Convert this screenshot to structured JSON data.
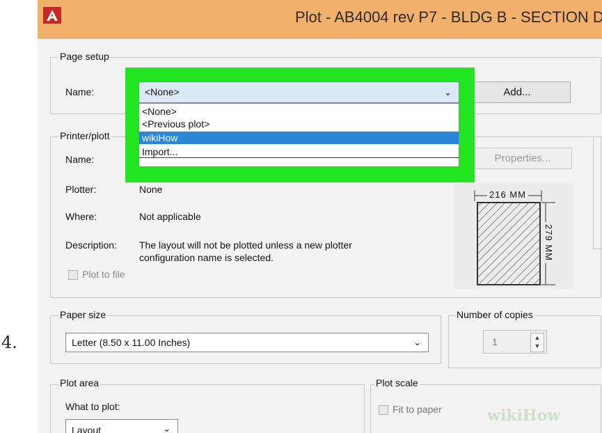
{
  "step_number": "4.",
  "window": {
    "title": "Plot - AB4004 rev P7 - BLDG B - SECTION D"
  },
  "page_setup": {
    "group_label": "Page setup",
    "name_label": "Name:",
    "name_value": "<None>",
    "add_button": "Add...",
    "dropdown_options": [
      "<None>",
      "<Previous plot>",
      "wikiHow",
      "Import..."
    ],
    "selected_option": "wikiHow"
  },
  "printer": {
    "group_label": "Printer/plott",
    "name_label": "Name:",
    "properties_button": "Properties...",
    "plotter_label": "Plotter:",
    "plotter_value": "None",
    "where_label": "Where:",
    "where_value": "Not applicable",
    "description_label": "Description:",
    "description_line1": "The layout will not be plotted unless a new plotter",
    "description_line2": "configuration name is selected.",
    "plot_to_file": "Plot to file",
    "paper_width": "216 MM",
    "paper_height": "279 MM"
  },
  "paper_size": {
    "group_label": "Paper size",
    "value": "Letter (8.50 x 11.00 Inches)"
  },
  "copies": {
    "group_label": "Number of copies",
    "value": "1"
  },
  "plot_area": {
    "group_label": "Plot area",
    "what_to_plot_label": "What to plot:",
    "what_to_plot_value": "Layout"
  },
  "plot_scale": {
    "group_label": "Plot scale",
    "fit_to_paper": "Fit to paper"
  },
  "watermark": "wikiHow",
  "colors": {
    "highlight": "#22e622",
    "titlebar": "#f2b06d",
    "selection": "#2a86d8"
  }
}
